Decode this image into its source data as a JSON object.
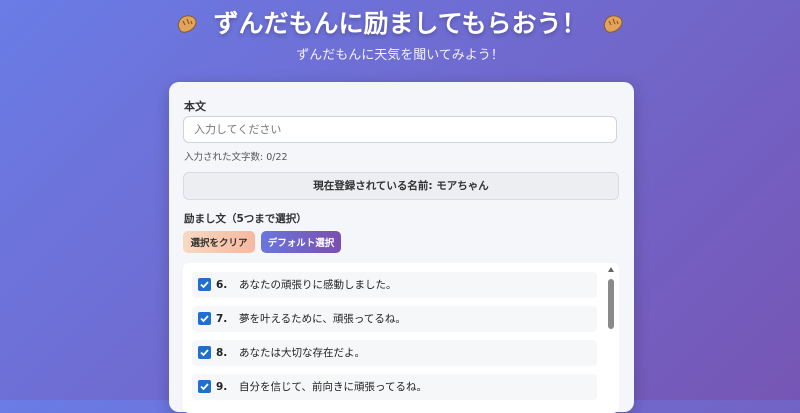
{
  "header": {
    "title": "ずんだもんに励ましてもらおう！",
    "subtitle": "ずんだもんに天気を聞いてみよう！",
    "left_icon": "bread-icon",
    "right_icon": "bread-icon"
  },
  "form": {
    "main_label": "本文",
    "input_placeholder": "入力してください",
    "input_value": "",
    "char_count": "入力された文字数: 0/22",
    "registered_name": "現在登録されている名前: モアちゃん"
  },
  "encouragement": {
    "label": "励まし文（5つまで選択）",
    "clear_button": "選択をクリア",
    "default_button": "デフォルト選択",
    "items": [
      {
        "number": "6.",
        "text": "あなたの頑張りに感動しました。",
        "checked": true
      },
      {
        "number": "7.",
        "text": "夢を叶えるために、頑張ってるね。",
        "checked": true
      },
      {
        "number": "8.",
        "text": "あなたは大切な存在だよ。",
        "checked": true
      },
      {
        "number": "9.",
        "text": "自分を信じて、前向きに頑張ってるね。",
        "checked": true
      }
    ]
  },
  "colors": {
    "accent": "#1f6fd1",
    "bg_start": "#6a7ce6",
    "bg_end": "#7656b5"
  }
}
